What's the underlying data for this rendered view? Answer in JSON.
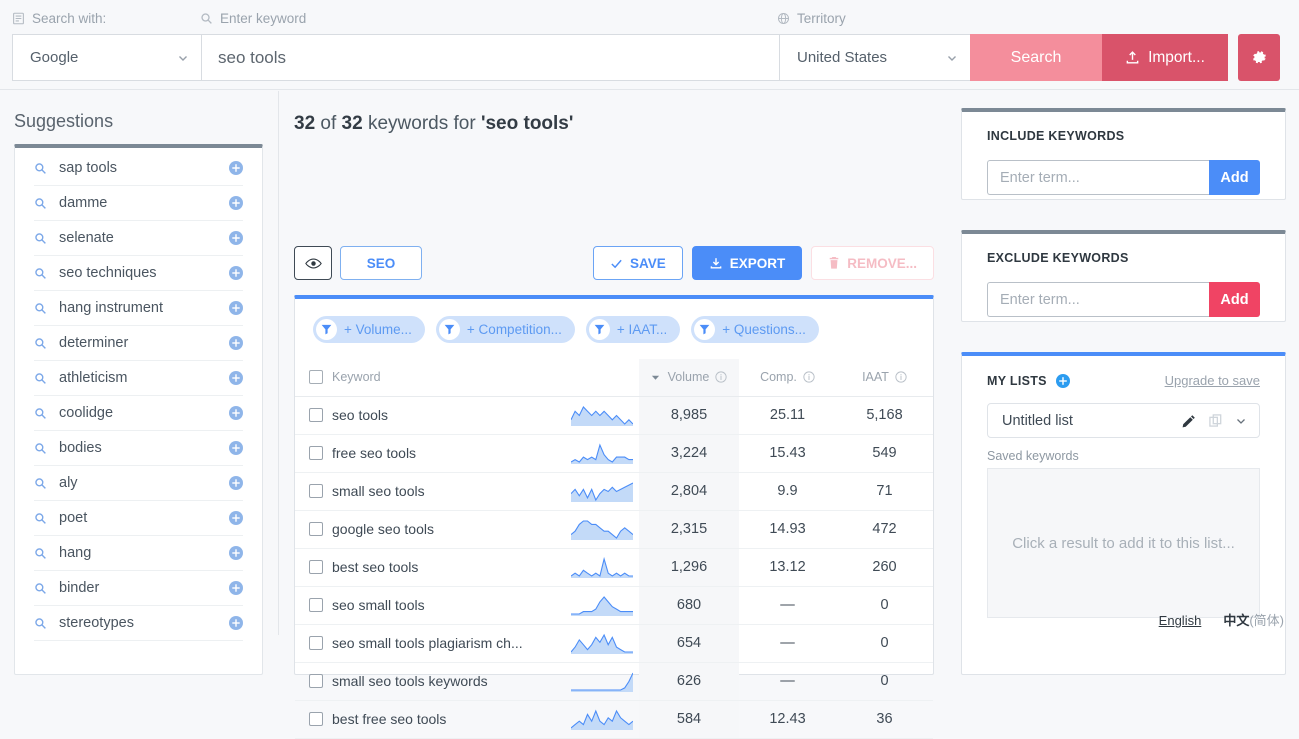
{
  "topbar": {
    "label_engine": "Search with:",
    "label_keyword": "Enter keyword",
    "label_territory": "Territory",
    "engine_value": "Google",
    "keyword_value": "seo tools",
    "territory_value": "United States",
    "search_label": "Search",
    "import_label": "Import...",
    "accent_search": "#f48e9c",
    "accent_import": "#d9536a"
  },
  "sidebar": {
    "title": "Suggestions",
    "items": [
      {
        "label": "sap tools"
      },
      {
        "label": "damme"
      },
      {
        "label": "selenate"
      },
      {
        "label": "seo techniques"
      },
      {
        "label": "hang instrument"
      },
      {
        "label": "determiner"
      },
      {
        "label": "athleticism"
      },
      {
        "label": "coolidge"
      },
      {
        "label": "bodies"
      },
      {
        "label": "aly"
      },
      {
        "label": "poet"
      },
      {
        "label": "hang"
      },
      {
        "label": "binder"
      },
      {
        "label": "stereotypes"
      }
    ]
  },
  "main": {
    "title_count": "32",
    "title_total": "32",
    "title_mid": " of ",
    "title_for": " keywords for ",
    "title_keyword": "'seo tools'",
    "seo_label": "SEO",
    "save_label": "SAVE",
    "export_label": "EXPORT",
    "remove_label": "REMOVE...",
    "chips": [
      {
        "label": "+ Volume..."
      },
      {
        "label": "+ Competition..."
      },
      {
        "label": "+ IAAT..."
      },
      {
        "label": "+ Questions..."
      }
    ],
    "columns": {
      "keyword": "Keyword",
      "volume": "Volume",
      "comp": "Comp.",
      "iaat": "IAAT"
    },
    "sorted_by": "Volume",
    "sort_direction": "desc",
    "rows": [
      {
        "keyword": "seo tools",
        "volume": "8,985",
        "comp": "25.11",
        "iaat": "5,168",
        "spark": "5,7,6,8,7,6,7,6,7,6,5,6,5,4,5,4"
      },
      {
        "keyword": "free seo tools",
        "volume": "3,224",
        "comp": "15.43",
        "iaat": "549",
        "spark": "2,3,2,4,3,4,3,9,5,3,2,4,4,4,3,3"
      },
      {
        "keyword": "small seo tools",
        "volume": "2,804",
        "comp": "9.9",
        "iaat": "71",
        "spark": "4,6,3,6,2,6,1,4,6,5,7,5,6,7,8,9"
      },
      {
        "keyword": "google seo tools",
        "volume": "2,315",
        "comp": "14.93",
        "iaat": "472",
        "spark": "3,4,6,7,7,6,6,5,4,4,3,2,4,5,4,3"
      },
      {
        "keyword": "best seo tools",
        "volume": "1,296",
        "comp": "13.12",
        "iaat": "260",
        "spark": "3,4,3,5,4,3,4,3,9,4,3,4,3,4,3,3"
      },
      {
        "keyword": "seo small tools",
        "volume": "680",
        "comp": "—",
        "iaat": "0",
        "spark": "1,1,1,2,2,2,3,6,8,6,4,3,2,2,2,2"
      },
      {
        "keyword": "seo small tools plagiarism ch...",
        "volume": "654",
        "comp": "—",
        "iaat": "0",
        "spark": "1,3,6,4,2,4,7,5,8,4,7,3,2,1,1,1"
      },
      {
        "keyword": "small seo tools keywords",
        "volume": "626",
        "comp": "—",
        "iaat": "0",
        "spark": "1,1,1,1,1,1,1,1,1,1,1,1,1,2,5,9"
      },
      {
        "keyword": "best free seo tools",
        "volume": "584",
        "comp": "12.43",
        "iaat": "36",
        "spark": "1,2,3,2,5,3,6,3,2,4,3,6,4,3,2,3"
      }
    ]
  },
  "right": {
    "include": {
      "title": "INCLUDE KEYWORDS",
      "placeholder": "Enter term...",
      "add_label": "Add",
      "add_color": "#4b8df8"
    },
    "exclude": {
      "title": "EXCLUDE KEYWORDS",
      "placeholder": "Enter term...",
      "add_label": "Add",
      "add_color": "#f04464"
    },
    "lists": {
      "title": "MY LISTS",
      "upgrade_label": "Upgrade to save",
      "selected_list": "Untitled list",
      "saved_label": "Saved keywords",
      "empty_text": "Click a result to add it to this list..."
    }
  },
  "footer": {
    "lang_en": "English",
    "lang_zh": "中文",
    "lang_zh_sub": "(简体)"
  }
}
